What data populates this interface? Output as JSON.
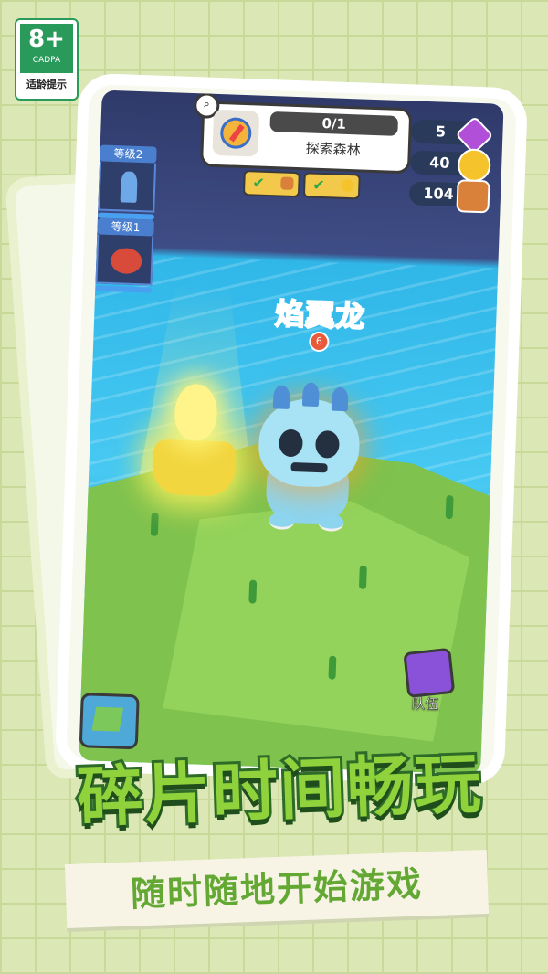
{
  "age_rating": {
    "rating": "8+",
    "org": "CADPA",
    "caption": "适龄提示"
  },
  "quest": {
    "progress": "0/1",
    "name": "探索森林"
  },
  "resources": [
    {
      "icon": "purple-gem-icon",
      "value": "5"
    },
    {
      "icon": "gold-coin-icon",
      "value": "40"
    },
    {
      "icon": "wood-barrel-icon",
      "value": "104"
    }
  ],
  "level_cards": [
    {
      "label": "等级2",
      "creature": "blue-serpent"
    },
    {
      "label": "等级1",
      "creature": "red-crab"
    }
  ],
  "creature": {
    "name": "焰翼龙",
    "level": "6"
  },
  "team_button": {
    "label": "队伍"
  },
  "headline": "碎片时间畅玩",
  "subheadline": "随时随地开始游戏",
  "colors": {
    "accent_green": "#8fd23c",
    "dark_green": "#2e6b28",
    "sky_water": "#47c9f2",
    "name_orange": "#ff6a3a"
  }
}
